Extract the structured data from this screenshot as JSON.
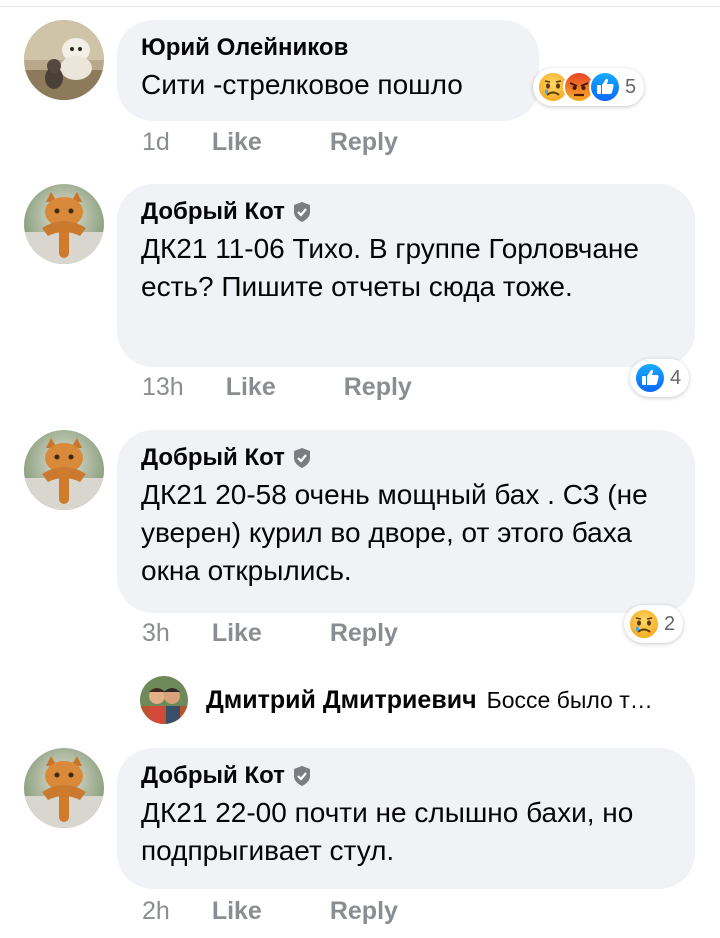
{
  "comments": [
    {
      "author": "Юрий Олейников",
      "verified": false,
      "avatar": "dog-photo",
      "text": "Сити -стрелковое пошло",
      "time": "1d",
      "like": "Like",
      "reply": "Reply",
      "reactions": [
        "sad-icon",
        "angry-icon",
        "like-icon"
      ],
      "reaction_count": "5"
    },
    {
      "author": "Добрый Кот",
      "verified": true,
      "avatar": "cat-photo",
      "text": "ДК21 11-06 Тихо. В группе Горловчане есть? Пишите отчеты сюда тоже.",
      "time": "13h",
      "like": "Like",
      "reply": "Reply",
      "reactions": [
        "like-icon"
      ],
      "reaction_count": "4"
    },
    {
      "author": "Добрый Кот",
      "verified": true,
      "avatar": "cat-photo",
      "text": "ДК21  20-58 очень мощный бах . СЗ (не уверен) курил во дворе, от этого баха окна открылись.",
      "time": "3h",
      "like": "Like",
      "reply": "Reply",
      "reactions": [
        "sad-icon"
      ],
      "reaction_count": "2"
    },
    {
      "author": "Добрый Кот",
      "verified": true,
      "avatar": "cat-photo",
      "text": "ДК21 22-00 почти не слышно бахи, но подпрыгивает стул.",
      "time": "2h",
      "like": "Like",
      "reply": "Reply",
      "reactions": [],
      "reaction_count": ""
    }
  ],
  "reply_preview": {
    "author": "Дмитрий Дмитриевич",
    "text": "Боссе было т…",
    "avatar": "person-photo"
  },
  "colors": {
    "bubble": "#f0f2f5",
    "meta": "#8a8d91",
    "like_blue": "#1877f2",
    "angry": "#e9710f",
    "sad": "#f7b125"
  }
}
